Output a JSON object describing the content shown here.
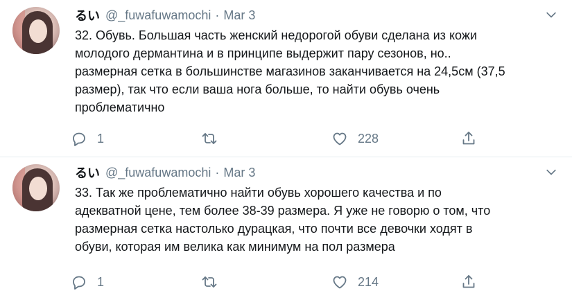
{
  "tweets": [
    {
      "display_name": "るい",
      "handle": "@_fuwafuwamochi",
      "separator": "·",
      "date": "Mar 3",
      "lines": [
        "32. Обувь. Большая часть женский недорогой обуви сделана из кожи",
        "молодого дермантина и в принципе выдержит пару сезонов, но..",
        "размерная сетка в большинстве магазинов заканчивается на 24,5см (37,5",
        "размер), так что если ваша нога больше, то найти обувь очень",
        "проблематично"
      ],
      "replies": "1",
      "retweets": "",
      "likes": "228"
    },
    {
      "display_name": "るい",
      "handle": "@_fuwafuwamochi",
      "separator": "·",
      "date": "Mar 3",
      "lines": [
        "33. Так же проблематично найти обувь хорошего качества и по",
        "адекватной цене, тем более 38-39 размера. Я уже не говорю о том, что",
        "размерная сетка настолько дурацкая, что почти все девочки ходят в",
        "обуви, которая им велика как минимум на пол размера"
      ],
      "replies": "1",
      "retweets": "",
      "likes": "214"
    }
  ],
  "icons": {
    "reply": "reply-icon",
    "retweet": "retweet-icon",
    "like": "heart-icon",
    "share": "share-icon",
    "menu": "chevron-down-icon"
  },
  "colors": {
    "text": "#14171a",
    "secondary": "#657786",
    "divider": "#e6ecf0"
  }
}
